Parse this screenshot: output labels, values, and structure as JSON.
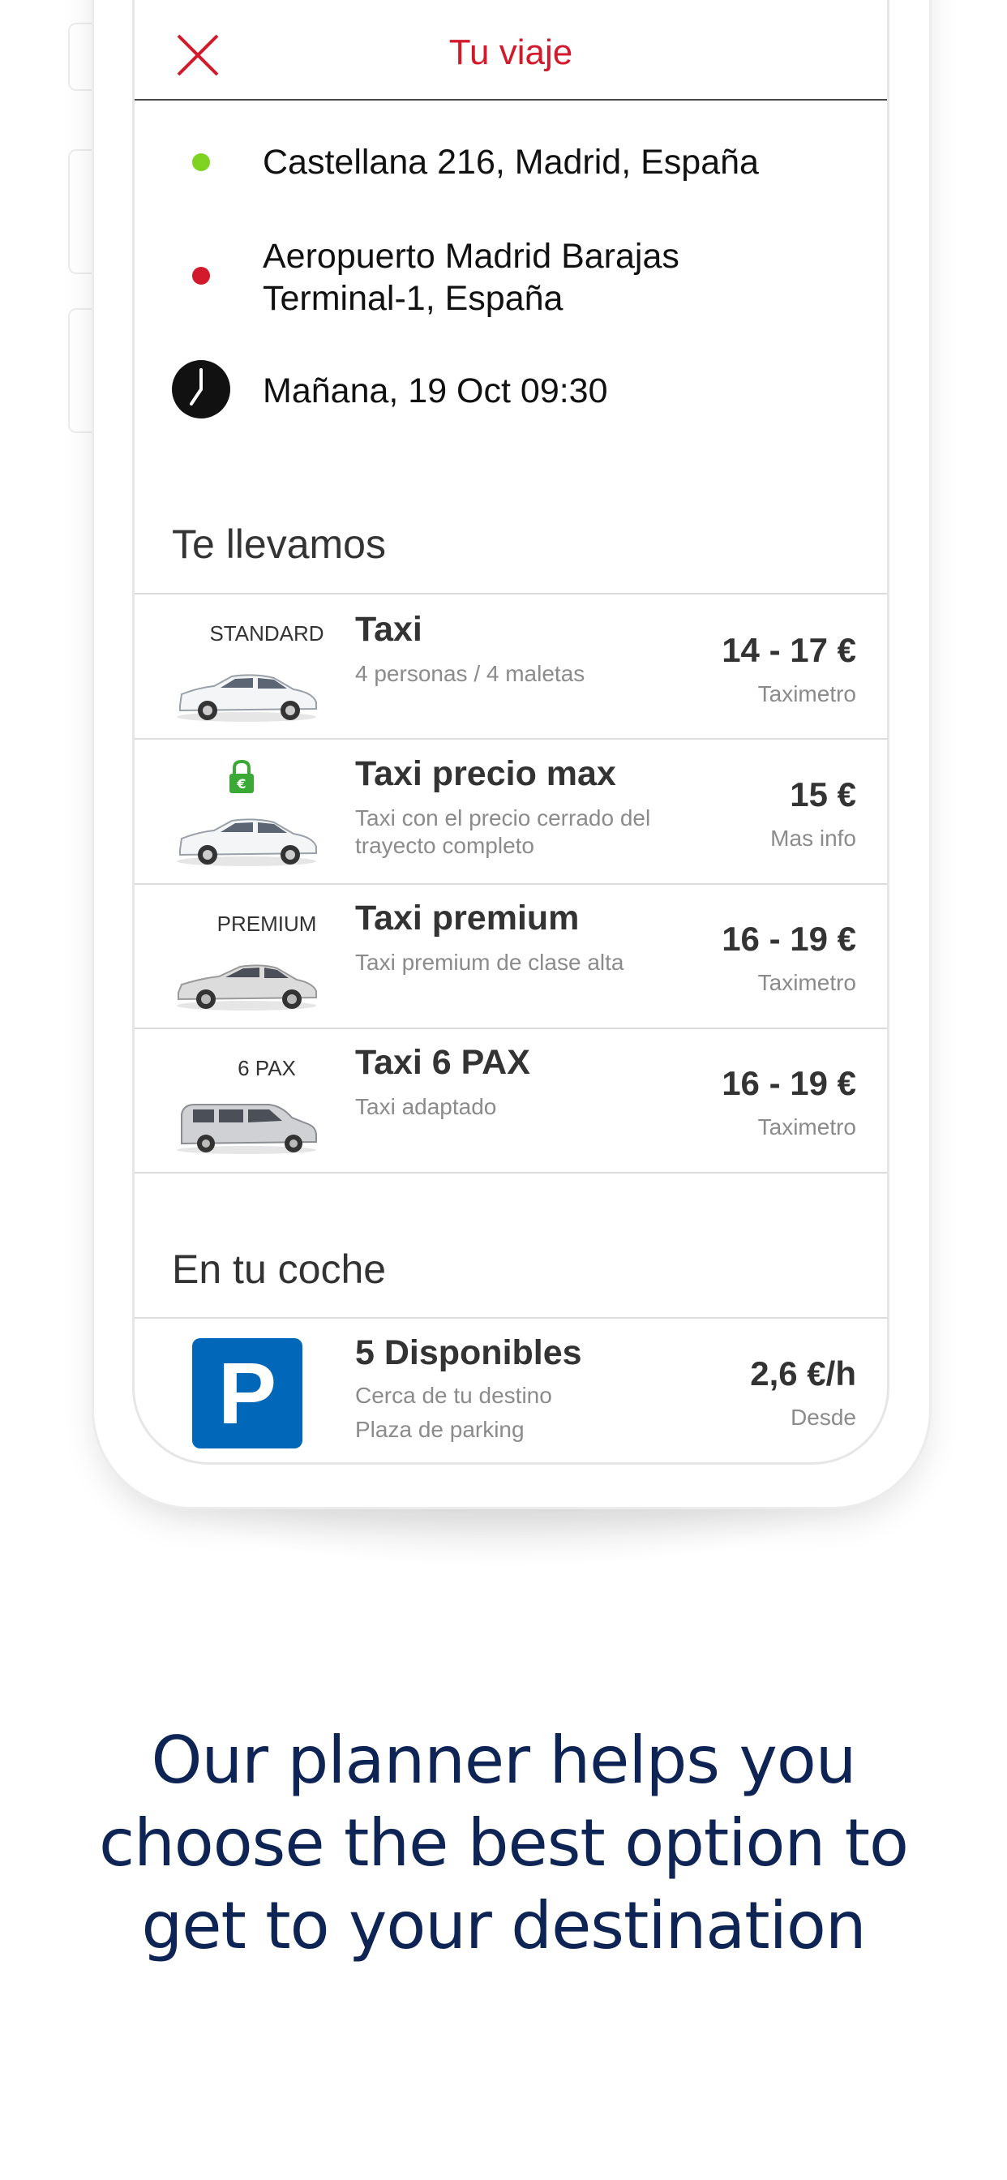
{
  "header": {
    "title": "Tu viaje"
  },
  "trip": {
    "origin": "Castellana 216, Madrid, España",
    "destination_line1": "Aeropuerto Madrid Barajas",
    "destination_line2": "Terminal-1, España",
    "datetime": "Mañana, 19 Oct 09:30"
  },
  "colors": {
    "accent": "#d21a2c",
    "origin_dot": "#7ed321",
    "destination_dot": "#d21a2c",
    "parking_blue": "#0067b9",
    "lock_green": "#3aa935",
    "tagline": "#0e2454"
  },
  "te_llevamos": {
    "title": "Te llevamos",
    "options": [
      {
        "badge": "STANDARD",
        "title": "Taxi",
        "subtitle_line1": "4 personas / 4 maletas",
        "subtitle_line2": "",
        "price": "14 - 17 €",
        "price_note": "Taximetro",
        "icon": "taxi-car-icon"
      },
      {
        "badge": "",
        "title": "Taxi precio max",
        "subtitle_line1": "Taxi con el precio cerrado del",
        "subtitle_line2": "trayecto completo",
        "price": "15 €",
        "price_note": "Mas info",
        "icon": "taxi-car-icon"
      },
      {
        "badge": "PREMIUM",
        "title": "Taxi premium",
        "subtitle_line1": "Taxi premium de clase alta",
        "subtitle_line2": "",
        "price": "16 - 19 €",
        "price_note": "Taximetro",
        "icon": "sedan-car-icon"
      },
      {
        "badge": "6 PAX",
        "title": "Taxi 6 PAX",
        "subtitle_line1": "Taxi adaptado",
        "subtitle_line2": "",
        "price": "16 - 19 €",
        "price_note": "Taximetro",
        "icon": "van-icon"
      }
    ]
  },
  "en_tu_coche": {
    "title": "En tu coche",
    "parking": {
      "icon_letter": "P",
      "title": "5 Disponibles",
      "subtitle_line1": "Cerca de tu destino",
      "subtitle_line2": "Plaza de parking",
      "price": "2,6 €/h",
      "price_note": "Desde"
    }
  },
  "tagline": {
    "line1": "Our planner helps you",
    "line2": "choose the best option to",
    "line3": "get to your destination"
  }
}
